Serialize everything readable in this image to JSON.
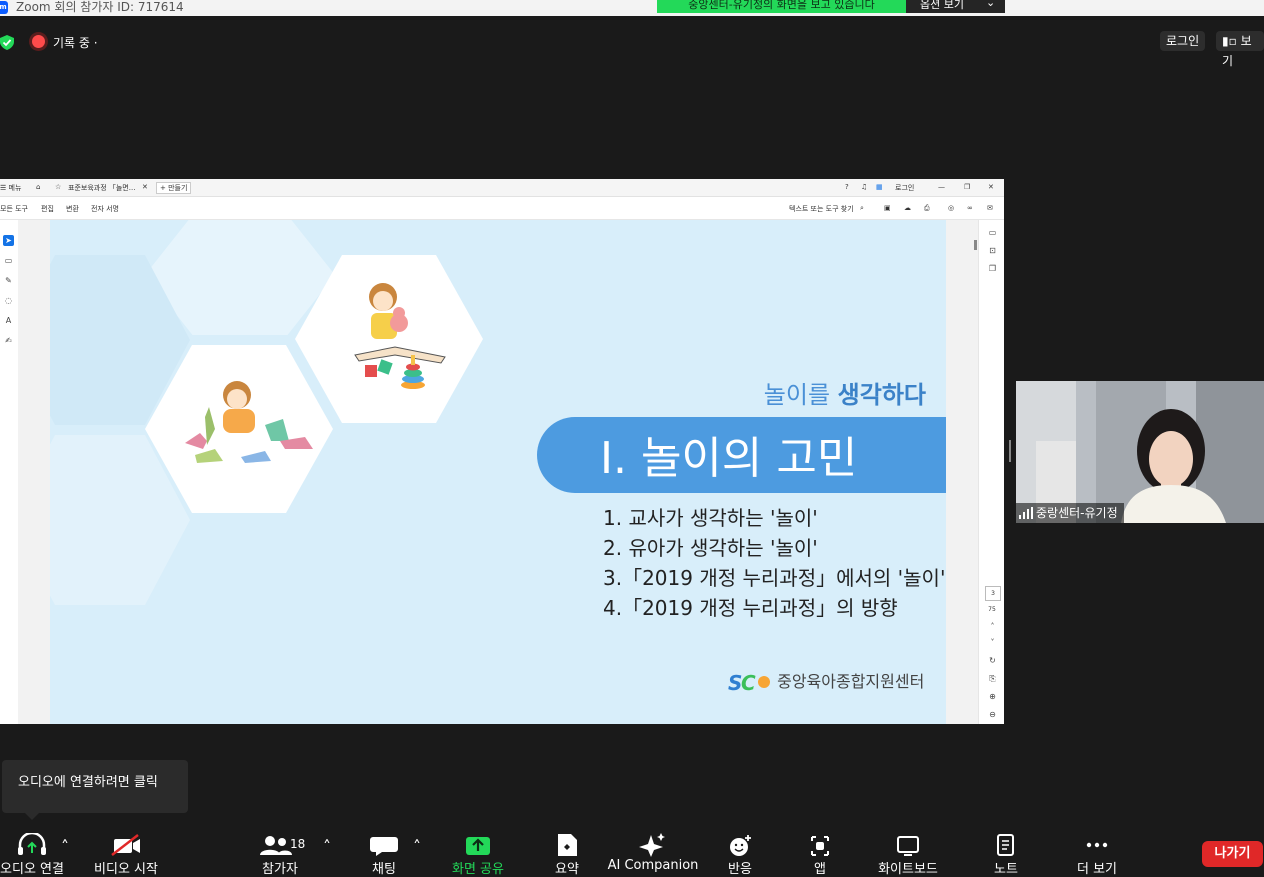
{
  "window": {
    "title": "Zoom 회의 참가자 ID: 717614",
    "logo_text": "zm"
  },
  "share_banner": {
    "message": "중앙센터-유기정의 화면을 보고 있습니다",
    "options_label": "옵션 보기",
    "chevron": "⌄"
  },
  "status": {
    "recording_label": "기록 중 ·",
    "login_label": "로그인",
    "view_label": "보기"
  },
  "viewer": {
    "tab_menu": "메뉴",
    "tab_title": "표준보육과정 「놀면...",
    "tab_close": "✕",
    "new_tab": "+ 만들기",
    "tab_login": "로그인",
    "menu_items": [
      "모든 도구",
      "편집",
      "변환",
      "전자 서명"
    ],
    "search_placeholder": "텍스트 또는 도구 찾기",
    "page_current": "3",
    "page_total": "75"
  },
  "slide": {
    "subtitle_plain": "놀이를 ",
    "subtitle_bold": "생각하다",
    "chapter_title": "Ⅰ. 놀이의 고민",
    "agenda": [
      "1. 교사가 생각하는 '놀이'",
      "2. 유아가 생각하는 '놀이'",
      "3.「2019 개정 누리과정」에서의 '놀이'",
      "4.「2019 개정 누리과정」의 방향"
    ],
    "org_logo_text": "중앙육아종합지원센터"
  },
  "webcam": {
    "participant_name": "중랑센터-유기정"
  },
  "tooltip": {
    "text": "오디오에 연결하려면 클릭"
  },
  "toolbar": {
    "audio": "오디오 연결",
    "video": "비디오 시작",
    "participants": "참가자",
    "participant_count": "18",
    "chat": "채팅",
    "share": "화면 공유",
    "summary": "요약",
    "ai": "AI Companion",
    "reactions": "반응",
    "apps": "앱",
    "whiteboard": "화이트보드",
    "notes": "노트",
    "more": "더 보기",
    "leave": "나가기"
  },
  "colors": {
    "share_green": "#23d959",
    "slide_bg": "#d8eefa",
    "pill_blue": "#4d9be0",
    "leave_red": "#e02828",
    "record_red": "#ff4b4b"
  }
}
